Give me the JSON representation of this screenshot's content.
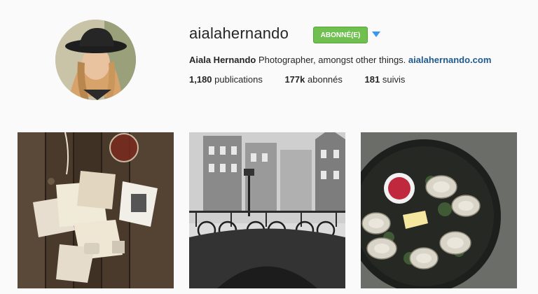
{
  "profile": {
    "username": "aialahernando",
    "follow_button": "ABONNÉ(E)",
    "full_name": "Aiala Hernando",
    "bio_text": "Photographer, amongst other things.",
    "website": "aialahernando.com",
    "stats": [
      {
        "value": "1,180",
        "label": "publications"
      },
      {
        "value": "177k",
        "label": "abonnés"
      },
      {
        "value": "181",
        "label": "suivis"
      }
    ]
  },
  "posts": [
    {
      "subject": "letters-and-wine-on-wooden-table"
    },
    {
      "subject": "foggy-canal-bridge-with-bicycles"
    },
    {
      "subject": "oysters-on-dark-plate"
    }
  ],
  "colors": {
    "follow_green": "#70c050",
    "link_blue": "#1f5a8c",
    "caret_blue": "#3897f0"
  }
}
